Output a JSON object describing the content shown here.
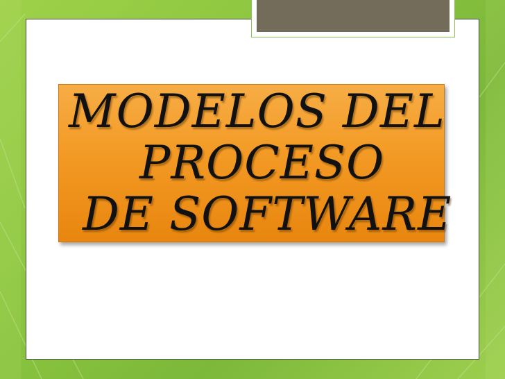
{
  "slide": {
    "title_lines": [
      "MODELOS DEL",
      "PROCESO",
      "DE SOFTWARE"
    ]
  },
  "colors": {
    "background": "#8cc63f",
    "title_box": "#f39a24",
    "header_tab": "#736c5a",
    "slide_frame": "#ffffff"
  }
}
